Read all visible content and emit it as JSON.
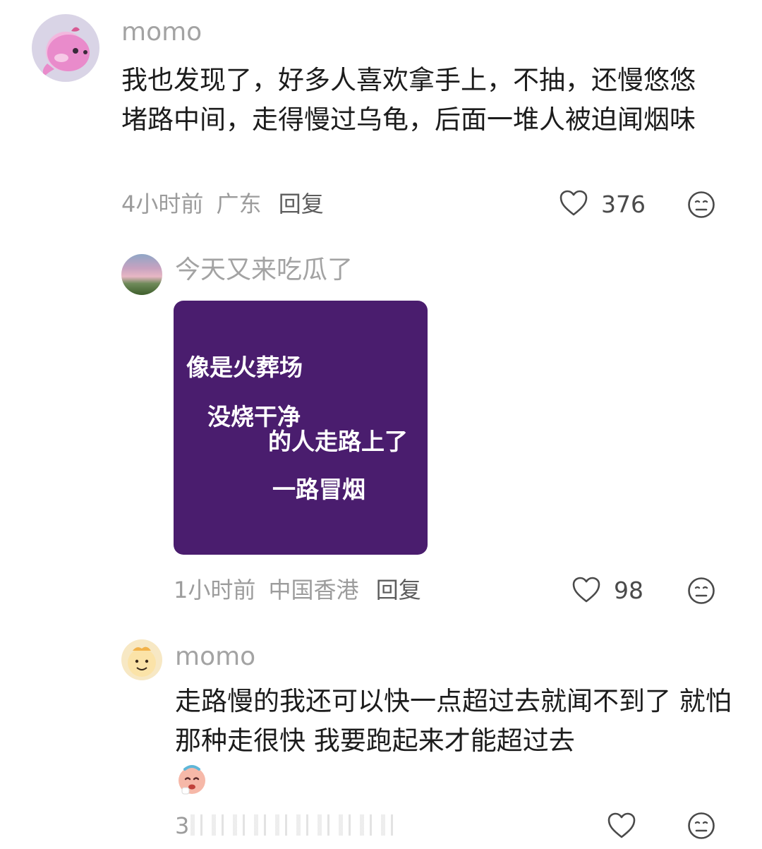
{
  "comments": [
    {
      "username": "momo",
      "text": "我也发现了，好多人喜欢拿手上，不抽，还慢悠悠堵路中间，走得慢过乌龟，后面一堆人被迫闻烟味",
      "time": "4小时前",
      "location": "广东",
      "reply_label": "回复",
      "likes": "376"
    },
    {
      "username": "今天又来吃瓜了",
      "image_text": [
        "像是火葬场",
        "没烧干净",
        "的人走路上了",
        "一路冒烟"
      ],
      "time": "1小时前",
      "location": "中国香港",
      "reply_label": "回复",
      "likes": "98"
    },
    {
      "username": "momo",
      "text": "走路慢的我还可以快一点超过去就闻不到了 就怕那种走很快 我要跑起来才能超过去",
      "partial_meta": "3"
    }
  ],
  "icons": {
    "like": "heart-outline-icon",
    "dislike": "meh-face-icon"
  },
  "colors": {
    "image_card": "#4a1d6e",
    "username": "#a3a3a3",
    "meta": "#9c9c9c"
  }
}
